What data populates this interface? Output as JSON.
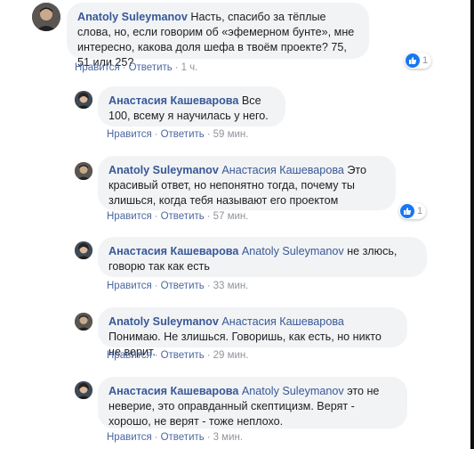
{
  "colors": {
    "author": "#385898",
    "meta": "#90949c",
    "bubble": "#f2f3f5",
    "like": "#1877f2"
  },
  "comments": [
    {
      "author": "Anatoly Suleymanov",
      "text": "Насть, спасибо за тёплые слова, но, если говорим об «эфемерном бунте», мне интересно, какова доля шефа в твоём проекте? 75, 51 или 25?",
      "like_label": "Нравится",
      "reply_label": "Ответить",
      "time": "1 ч.",
      "reactions": "1"
    },
    {
      "author": "Анастасия Кашеварова",
      "text": "Все 100, всему я научилась у него.",
      "like_label": "Нравится",
      "reply_label": "Ответить",
      "time": "59 мин."
    },
    {
      "author": "Anatoly Suleymanov",
      "mention": "Анастасия Кашеварова",
      "text": "Это красивый ответ, но непонятно тогда, почему ты злишься, когда тебя называют его проектом",
      "like_label": "Нравится",
      "reply_label": "Ответить",
      "time": "57 мин.",
      "reactions": "1"
    },
    {
      "author": "Анастасия Кашеварова",
      "mention": "Anatoly Suleymanov",
      "text": "не злюсь, говорю так как есть",
      "like_label": "Нравится",
      "reply_label": "Ответить",
      "time": "33 мин."
    },
    {
      "author": "Anatoly Suleymanov",
      "mention": "Анастасия Кашеварова",
      "text": "Понимаю. Не злишься. Говоришь, как есть, но никто не верит.",
      "like_label": "Нравится",
      "reply_label": "Ответить",
      "time": "29 мин."
    },
    {
      "author": "Анастасия Кашеварова",
      "mention": "Anatoly Suleymanov",
      "text": "это не неверие, это оправданный скептицизм. Верят - хорошо, не верят - тоже неплохо.",
      "like_label": "Нравится",
      "reply_label": "Ответить",
      "time": "3 мин."
    }
  ]
}
